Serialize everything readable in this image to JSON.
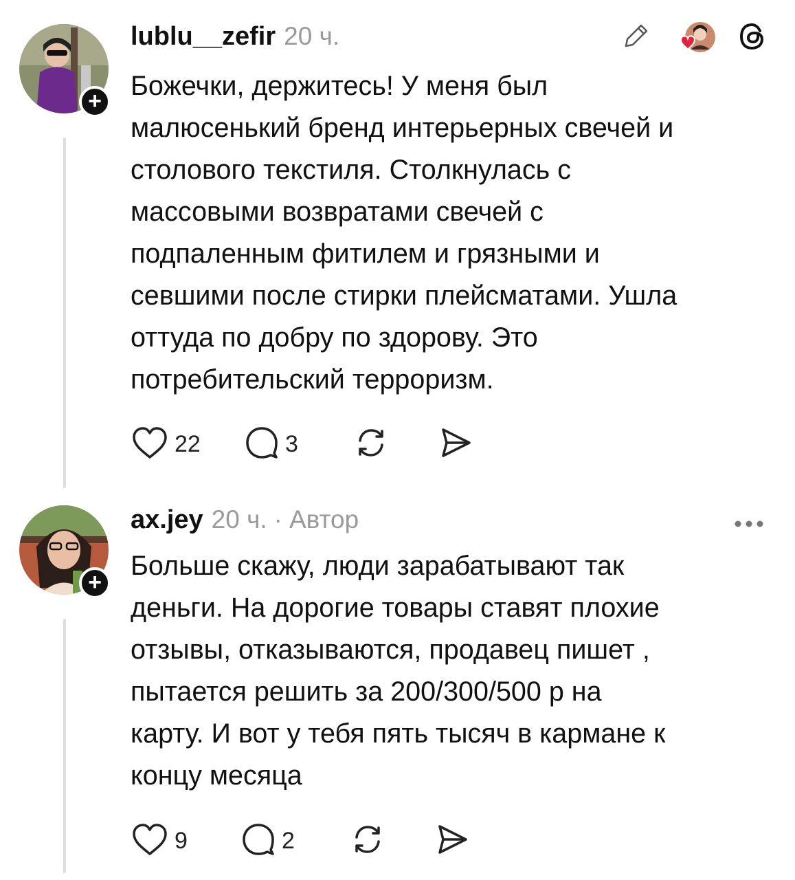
{
  "posts": [
    {
      "username": "lublu__zefir",
      "time": "20 ч.",
      "body": "Божечки, держитесь! У меня был\nмалюсенький бренд интерьерных свечей и\nстолового текстиля. Столкнулась с\nмассовыми возвратами свечей с\nподпаленным фитилем и грязными и\nсевшими после стирки плейсматами. Ушла\nоттуда по добру по здорову. Это\nпотребительский терроризм.",
      "likes": "22",
      "replies": "3",
      "header_icons": [
        "pencil-icon",
        "liked-by-avatar-icon",
        "threads-logo-icon"
      ]
    },
    {
      "username": "ax.jey",
      "time": "20 ч.",
      "separator": "·",
      "author_label": "Автор",
      "body": "Больше скажу, люди зарабатывают так\nденьги. На дорогие товары ставят плохие\nотзывы, отказываются, продавец пишет ,\nпытается решить за 200/300/500 р на\nкарту. И вот у тебя пять тысяч в кармане к\nконцу месяца",
      "likes": "9",
      "replies": "2",
      "header_icons": [
        "more-icon"
      ]
    }
  ],
  "follow_badge": "+",
  "colors": {
    "text": "#111111",
    "muted": "#9a9a9a",
    "thread_line": "#dedede",
    "like_red": "#e0243f"
  }
}
